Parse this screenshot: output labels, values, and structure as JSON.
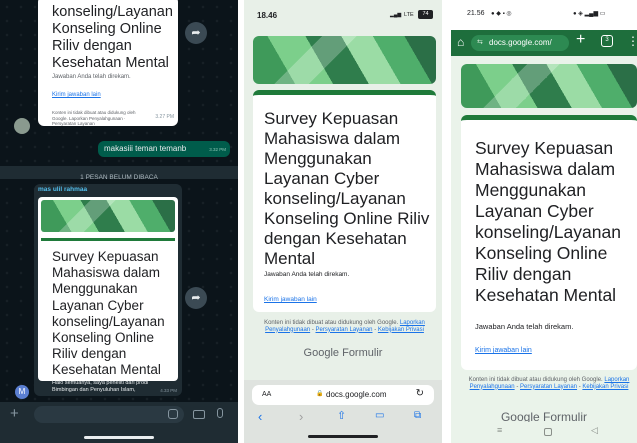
{
  "panel1": {
    "top_form_title": "konseling/Layanan Konseling Online Riliv dengan Kesehatan Mental",
    "top_response_text": "Jawaban Anda telah direkam.",
    "top_link": "Kirim jawaban lain",
    "top_footer": "Konten ini tidak dibuat atau didukung oleh Google. Laporkan Penyalahgunaan · Persyaratan Layanan",
    "top_time": "3.27 PM",
    "out_message": "makasiii teman temanb",
    "out_time": "3.32 PM",
    "unread_divider": "1 PESAN BELUM DIBACA",
    "sender_name": "mas ulil rahmaa",
    "form_title": "Survey Kepuasan Mahasiswa dalam Menggunakan Layanan Cyber konseling/Layanan Konseling Online Riliv dengan Kesehatan Mental",
    "msg_preview_1": "Halo semuanya, saya peneliti dari prodi",
    "msg_preview_2": "Bimbingan dan Penyuluhan Islam,",
    "msg_time": "4.33 PM",
    "avatar_letter": "M",
    "colors": {
      "bg": "#0b141a",
      "bubble_out": "#005c4b",
      "sender": "#53bdeb"
    }
  },
  "panel2": {
    "status_time": "18.46",
    "status_network": "LTE",
    "status_battery": "74",
    "form_title": "Survey Kepuasan Mahasiswa dalam Menggunakan Layanan Cyber konseling/Layanan Konseling Online Riliv dengan Kesehatan Mental",
    "response_text": "Jawaban Anda telah direkam.",
    "link": "Kirim jawaban lain",
    "footer_1": "Konten ini tidak dibuat atau didukung oleh Google.",
    "footer_link_1": "Laporkan Penyalahgunaan",
    "footer_link_2": "Persyaratan Layanan",
    "footer_link_3": "Kebijakan Privasi",
    "brand_google": "Google",
    "brand_forms": "Formulir",
    "text_size": "AA",
    "url": "docs.google.com"
  },
  "panel3": {
    "status_time": "21.56",
    "url": "docs.google.com/",
    "form_title": "Survey Kepuasan Mahasiswa dalam Menggunakan Layanan Cyber konseling/Layanan Konseling Online Riliv dengan Kesehatan Mental",
    "response_text": "Jawaban Anda telah direkam.",
    "link": "Kirim jawaban lain",
    "footer_1": "Konten ini tidak dibuat atau didukung oleh Google.",
    "footer_link_1": "Laporkan Penyalahgunaan",
    "footer_link_2": "Persyaratan Layanan",
    "footer_link_3": "Kebijakan Privasi",
    "brand_google": "Google",
    "brand_forms": "Formulir"
  }
}
